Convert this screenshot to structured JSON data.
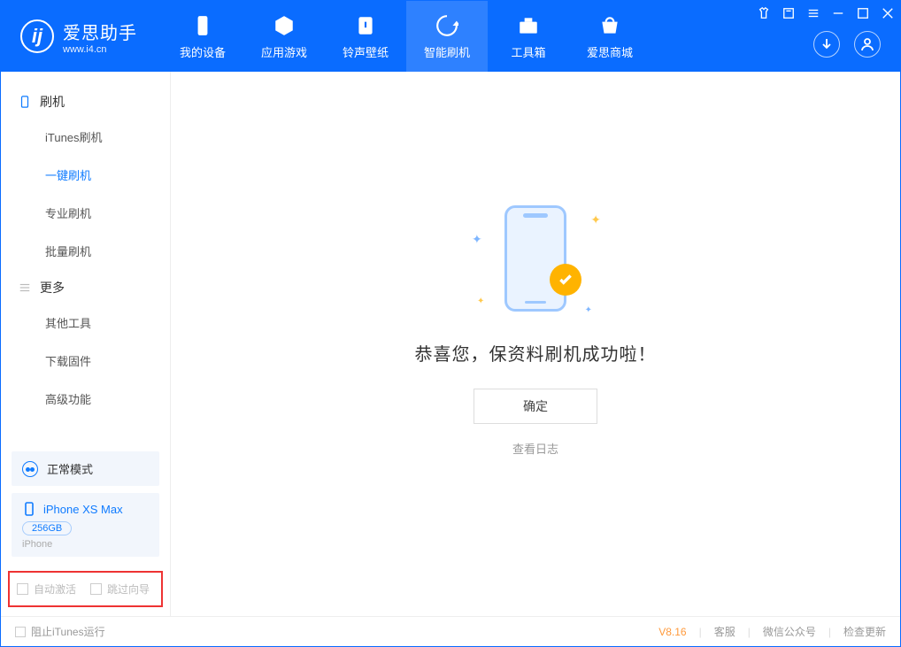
{
  "app": {
    "name_cn": "爱思助手",
    "name_en": "www.i4.cn"
  },
  "nav": {
    "items": [
      {
        "label": "我的设备"
      },
      {
        "label": "应用游戏"
      },
      {
        "label": "铃声壁纸"
      },
      {
        "label": "智能刷机"
      },
      {
        "label": "工具箱"
      },
      {
        "label": "爱思商城"
      }
    ]
  },
  "sidebar": {
    "group1": "刷机",
    "items1": [
      "iTunes刷机",
      "一键刷机",
      "专业刷机",
      "批量刷机"
    ],
    "group2": "更多",
    "items2": [
      "其他工具",
      "下载固件",
      "高级功能"
    ],
    "status_label": "正常模式",
    "device": {
      "name": "iPhone XS Max",
      "capacity": "256GB",
      "type": "iPhone"
    },
    "opt_auto_activate": "自动激活",
    "opt_skip_guide": "跳过向导"
  },
  "main": {
    "success_text": "恭喜您，保资料刷机成功啦！",
    "ok_label": "确定",
    "log_link": "查看日志"
  },
  "statusbar": {
    "block_itunes": "阻止iTunes运行",
    "version": "V8.16",
    "support": "客服",
    "wechat": "微信公众号",
    "update": "检查更新"
  }
}
